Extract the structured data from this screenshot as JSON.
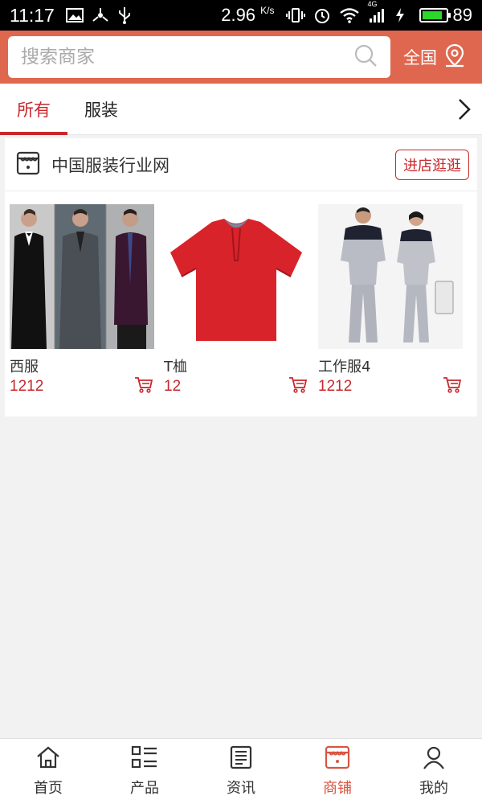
{
  "status_bar": {
    "time": "11:17",
    "network_speed": "2.96",
    "network_unit": "K/s",
    "network_type": "4G",
    "battery": "89",
    "battery_level": 0.89,
    "icons": [
      "image-icon",
      "usb-tether-icon",
      "usb-icon",
      "vibrate-icon",
      "alarm-icon",
      "wifi-icon",
      "signal-icon",
      "charging-icon",
      "battery-icon"
    ]
  },
  "header": {
    "search_placeholder": "搜索商家",
    "region": "全国",
    "bg_color": "#e0674f"
  },
  "tabs": [
    {
      "label": "所有",
      "active": true
    },
    {
      "label": "服装",
      "active": false
    }
  ],
  "store": {
    "name": "中国服装行业网",
    "enter_label": "进店逛逛",
    "products": [
      {
        "name": "西服",
        "price": "1212",
        "image": "suits-photo"
      },
      {
        "name": "T桖",
        "price": "12",
        "image": "red-polo-shirt-photo"
      },
      {
        "name": "工作服4",
        "price": "1212",
        "image": "workwear-photo"
      }
    ]
  },
  "bottom_nav": [
    {
      "label": "首页",
      "icon": "home-icon",
      "active": false
    },
    {
      "label": "产品",
      "icon": "list-icon",
      "active": false
    },
    {
      "label": "资讯",
      "icon": "news-icon",
      "active": false
    },
    {
      "label": "商铺",
      "icon": "shop-icon",
      "active": true
    },
    {
      "label": "我的",
      "icon": "user-icon",
      "active": false
    }
  ],
  "colors": {
    "accent": "#c8282d",
    "nav_active": "#d9543f"
  }
}
